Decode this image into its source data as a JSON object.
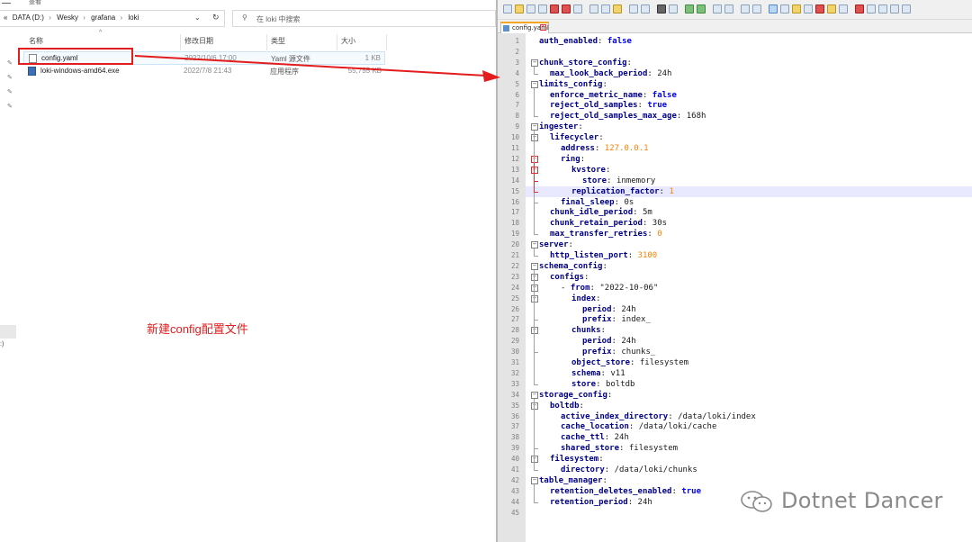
{
  "explorer": {
    "topstrip_text": "查看",
    "breadcrumb": {
      "overflow": "«",
      "items": [
        "DATA (D:)",
        "Wesky",
        "grafana",
        "loki"
      ]
    },
    "search_placeholder": "在 loki 中搜索",
    "columns": {
      "name": "名称",
      "date": "修改日期",
      "type": "类型",
      "size": "大小"
    },
    "files": [
      {
        "name": "config.yaml",
        "date": "2022/10/6 17:00",
        "type": "Yaml 源文件",
        "size": "1 KB",
        "selected": true,
        "icon": "yaml-file-icon"
      },
      {
        "name": "loki-windows-amd64.exe",
        "date": "2022/7/8 21:43",
        "type": "应用程序",
        "size": "55,755 KB",
        "selected": false,
        "icon": "exe-file-icon"
      }
    ],
    "nav_letter": ":)"
  },
  "annotation": {
    "text": "新建config配置文件",
    "color": "#e31d1d"
  },
  "editor": {
    "tab_label": "config.yaml",
    "current_line": 15,
    "lines": [
      {
        "n": 1,
        "indent": 0,
        "key": "auth_enabled",
        "value": "false",
        "vtype": "kw"
      },
      {
        "n": 2,
        "indent": 0
      },
      {
        "n": 3,
        "indent": 0,
        "key": "chunk_store_config",
        "fold": "open"
      },
      {
        "n": 4,
        "indent": 1,
        "key": "max_look_back_period",
        "value": "24h",
        "vtype": "s"
      },
      {
        "n": 5,
        "indent": 0,
        "key": "limits_config",
        "fold": "open"
      },
      {
        "n": 6,
        "indent": 1,
        "key": "enforce_metric_name",
        "value": "false",
        "vtype": "kw"
      },
      {
        "n": 7,
        "indent": 1,
        "key": "reject_old_samples",
        "value": "true",
        "vtype": "kw"
      },
      {
        "n": 8,
        "indent": 1,
        "key": "reject_old_samples_max_age",
        "value": "168h",
        "vtype": "s"
      },
      {
        "n": 9,
        "indent": 0,
        "key": "ingester",
        "fold": "open"
      },
      {
        "n": 10,
        "indent": 1,
        "key": "lifecycler",
        "fold": "open"
      },
      {
        "n": 11,
        "indent": 2,
        "key": "address",
        "value": "127.0.0.1",
        "vtype": "n"
      },
      {
        "n": 12,
        "indent": 2,
        "key": "ring",
        "fold": "open",
        "red": true
      },
      {
        "n": 13,
        "indent": 3,
        "key": "kvstore",
        "fold": "open",
        "red": true
      },
      {
        "n": 14,
        "indent": 4,
        "key": "store",
        "value": "inmemory",
        "vtype": "s"
      },
      {
        "n": 15,
        "indent": 3,
        "key": "replication_factor",
        "value": "1",
        "vtype": "n"
      },
      {
        "n": 16,
        "indent": 2,
        "key": "final_sleep",
        "value": "0s",
        "vtype": "s"
      },
      {
        "n": 17,
        "indent": 1,
        "key": "chunk_idle_period",
        "value": "5m",
        "vtype": "s"
      },
      {
        "n": 18,
        "indent": 1,
        "key": "chunk_retain_period",
        "value": "30s",
        "vtype": "s"
      },
      {
        "n": 19,
        "indent": 1,
        "key": "max_transfer_retries",
        "value": "0",
        "vtype": "n"
      },
      {
        "n": 20,
        "indent": 0,
        "key": "server",
        "fold": "open"
      },
      {
        "n": 21,
        "indent": 1,
        "key": "http_listen_port",
        "value": "3100",
        "vtype": "n"
      },
      {
        "n": 22,
        "indent": 0,
        "key": "schema_config",
        "fold": "open"
      },
      {
        "n": 23,
        "indent": 1,
        "key": "configs",
        "fold": "open"
      },
      {
        "n": 24,
        "indent": 2,
        "dash": true,
        "key": "from",
        "value": "\"2022-10-06\"",
        "vtype": "s",
        "fold": "open"
      },
      {
        "n": 25,
        "indent": 3,
        "key": "index",
        "fold": "open"
      },
      {
        "n": 26,
        "indent": 4,
        "key": "period",
        "value": "24h",
        "vtype": "s"
      },
      {
        "n": 27,
        "indent": 4,
        "key": "prefix",
        "value": "index_",
        "vtype": "s"
      },
      {
        "n": 28,
        "indent": 3,
        "key": "chunks",
        "fold": "open"
      },
      {
        "n": 29,
        "indent": 4,
        "key": "period",
        "value": "24h",
        "vtype": "s"
      },
      {
        "n": 30,
        "indent": 4,
        "key": "prefix",
        "value": "chunks_",
        "vtype": "s"
      },
      {
        "n": 31,
        "indent": 3,
        "key": "object_store",
        "value": "filesystem",
        "vtype": "s"
      },
      {
        "n": 32,
        "indent": 3,
        "key": "schema",
        "value": "v11",
        "vtype": "s"
      },
      {
        "n": 33,
        "indent": 3,
        "key": "store",
        "value": "boltdb",
        "vtype": "s"
      },
      {
        "n": 34,
        "indent": 0,
        "key": "storage_config",
        "fold": "open"
      },
      {
        "n": 35,
        "indent": 1,
        "key": "boltdb",
        "fold": "open"
      },
      {
        "n": 36,
        "indent": 2,
        "key": "active_index_directory",
        "value": "/data/loki/index",
        "vtype": "s"
      },
      {
        "n": 37,
        "indent": 2,
        "key": "cache_location",
        "value": "/data/loki/cache",
        "vtype": "s"
      },
      {
        "n": 38,
        "indent": 2,
        "key": "cache_ttl",
        "value": "24h",
        "vtype": "s"
      },
      {
        "n": 39,
        "indent": 2,
        "key": "shared_store",
        "value": "filesystem",
        "vtype": "s"
      },
      {
        "n": 40,
        "indent": 1,
        "key": "filesystem",
        "fold": "open"
      },
      {
        "n": 41,
        "indent": 2,
        "key": "directory",
        "value": "/data/loki/chunks",
        "vtype": "s"
      },
      {
        "n": 42,
        "indent": 0,
        "key": "table_manager",
        "fold": "open"
      },
      {
        "n": 43,
        "indent": 1,
        "key": "retention_deletes_enabled",
        "value": "true",
        "vtype": "kw"
      },
      {
        "n": 44,
        "indent": 1,
        "key": "retention_period",
        "value": "24h",
        "vtype": "s"
      },
      {
        "n": 45,
        "indent": 0
      }
    ]
  },
  "watermark": {
    "text": "Dotnet Dancer"
  },
  "colors": {
    "accent_red": "#e31d1d",
    "yaml_key": "#00008b",
    "yaml_bool": "#0000ff",
    "yaml_number": "#ff8000",
    "gutter": "#e4e4e4",
    "current_line": "#e8e8ff"
  }
}
